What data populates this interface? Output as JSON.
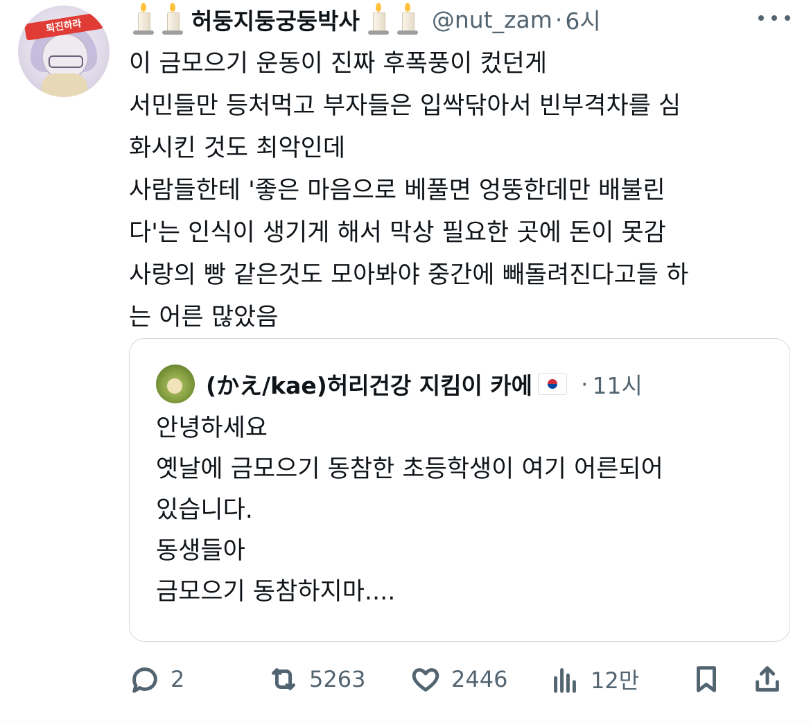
{
  "author": {
    "display_name": "허둥지둥궁둥박사",
    "handle": "@nut_zam",
    "separator": "·",
    "time": "6시",
    "avatar_band_text": "퇴진하라"
  },
  "tweet": {
    "text": "이 금모으기 운동이 진짜 후폭풍이 컸던게\n서민들만 등처먹고 부자들은 입싹닦아서 빈부격차를 심\n화시킨 것도 최악인데\n사람들한테 '좋은 마음으로 베풀면 엉뚱한데만 배불린\n다'는 인식이 생기게 해서 막상 필요한 곳에 돈이 못감\n사랑의 빵 같은것도 모아봐야 중간에 빼돌려진다고들 하\n는 어른 많았음"
  },
  "quote": {
    "display_name": "(かえ/kae)허리건강 지킴이 카에",
    "separator": "·",
    "time": "11시",
    "text": "안녕하세요\n옛날에 금모으기 동참한 초등학생이 여기 어른되어\n있습니다.\n동생들아\n금모으기 동참하지마...."
  },
  "actions": {
    "replies": "2",
    "retweets": "5263",
    "likes": "2446",
    "views": "12만"
  },
  "icons": [
    "candle-icon",
    "more-icon",
    "korea-flag-icon",
    "reply-icon",
    "retweet-icon",
    "like-icon",
    "views-icon",
    "bookmark-icon",
    "share-icon"
  ],
  "colors": {
    "text": "#0f1419",
    "secondary": "#536471",
    "border": "#cfd9de"
  }
}
